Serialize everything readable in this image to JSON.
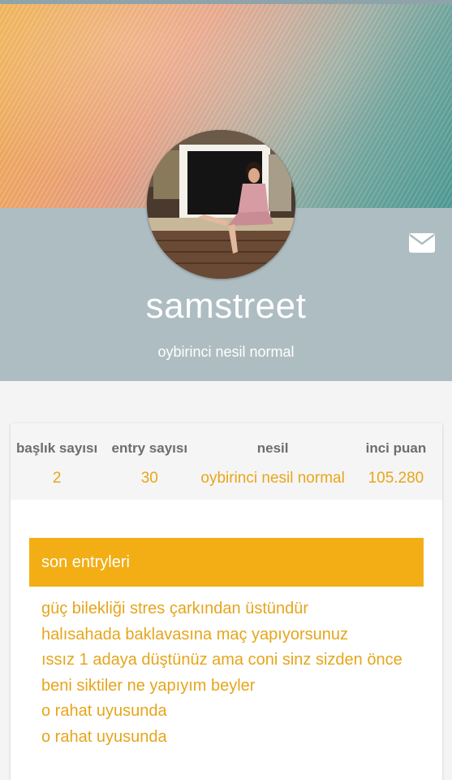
{
  "profile": {
    "username": "samstreet",
    "subtitle": "oybirinci nesil normal",
    "message_icon": "envelope-icon"
  },
  "colors": {
    "accent": "#f2ae14",
    "link": "#e6a51c",
    "header_band": "#aebdc2"
  },
  "stats": [
    {
      "label": "başlık sayısı",
      "value": "2"
    },
    {
      "label": "entry sayısı",
      "value": "30"
    },
    {
      "label": "nesil",
      "value": "oybirinci nesil normal"
    },
    {
      "label": "inci puan",
      "value": "105.280"
    }
  ],
  "recent": {
    "title": "son entryleri",
    "entries": [
      "güç bilekliği stres çarkından üstündür",
      "halısahada baklavasına maç yapıyorsunuz",
      "ıssız 1 adaya düştünüz ama coni sinz sizden önce",
      "beni siktiler ne yapıyım beyler",
      "o rahat uyusunda",
      "o rahat uyusunda"
    ]
  }
}
